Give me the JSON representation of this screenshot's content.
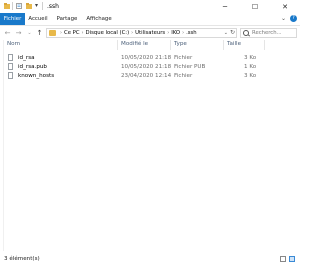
{
  "window": {
    "title": ".ssh",
    "colors": {
      "accent": "#1979ca",
      "folder": "#e8b94a"
    }
  },
  "ribbon": {
    "tabs": [
      {
        "label": "Fichier"
      },
      {
        "label": "Accueil"
      },
      {
        "label": "Partage"
      },
      {
        "label": "Affichage"
      }
    ],
    "help": "?"
  },
  "address": {
    "crumbs": [
      "Ce PC",
      "Disque local (C:)",
      "Utilisateurs",
      "IKO",
      ".ssh"
    ]
  },
  "search": {
    "placeholder": "Recherch..."
  },
  "columns": {
    "name": "Nom",
    "modified": "Modifié le",
    "type": "Type",
    "size": "Taille"
  },
  "files": [
    {
      "name": "id_rsa",
      "modified": "10/05/2020 21:18",
      "type": "Fichier",
      "size": "3 Ko"
    },
    {
      "name": "id_rsa.pub",
      "modified": "10/05/2020 21:18",
      "type": "Fichier PUB",
      "size": "1 Ko"
    },
    {
      "name": "known_hosts",
      "modified": "23/04/2020 12:14",
      "type": "Fichier",
      "size": "3 Ko"
    }
  ],
  "status": {
    "count": "3 élément(s)"
  }
}
